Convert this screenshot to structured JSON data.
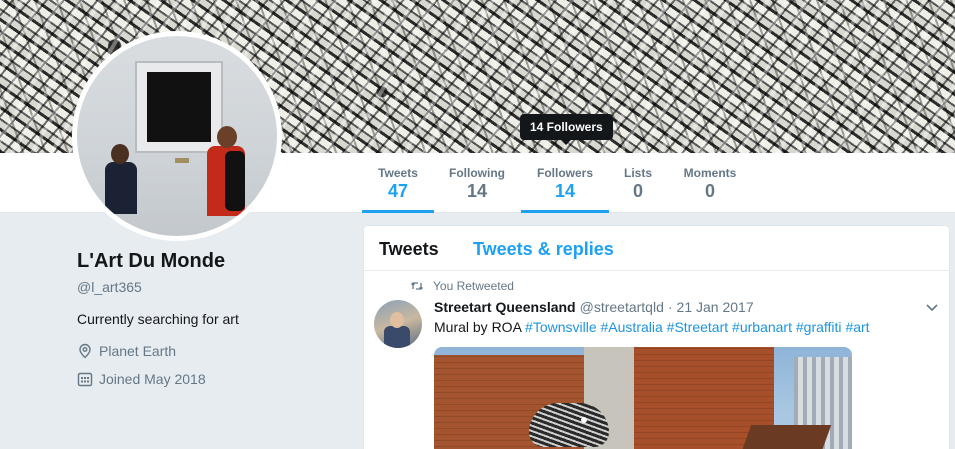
{
  "tooltip": {
    "followers_hover": "14 Followers"
  },
  "nav": {
    "stats": [
      {
        "label": "Tweets",
        "value": "47"
      },
      {
        "label": "Following",
        "value": "14"
      },
      {
        "label": "Followers",
        "value": "14"
      },
      {
        "label": "Lists",
        "value": "0"
      },
      {
        "label": "Moments",
        "value": "0"
      }
    ]
  },
  "profile": {
    "name": "L'Art Du Monde",
    "handle": "@l_art365",
    "bio": "Currently searching for art",
    "location": "Planet Earth",
    "joined": "Joined May 2018"
  },
  "timeline": {
    "tabs": [
      "Tweets",
      "Tweets & replies"
    ],
    "tweet": {
      "retweet_context": "You Retweeted",
      "author_name": "Streetart Queensland",
      "author_handle": "@streetartqld",
      "separator": "·",
      "date": "21 Jan 2017",
      "text_prefix": "Mural by ROA",
      "hashtags": [
        "#Townsville",
        "#Australia",
        "#Streetart",
        "#urbanart",
        "#graffiti",
        "#art"
      ]
    }
  },
  "colors": {
    "accent": "#1da1f2",
    "muted": "#657786",
    "text": "#14171a",
    "background": "#e6ecf0"
  }
}
